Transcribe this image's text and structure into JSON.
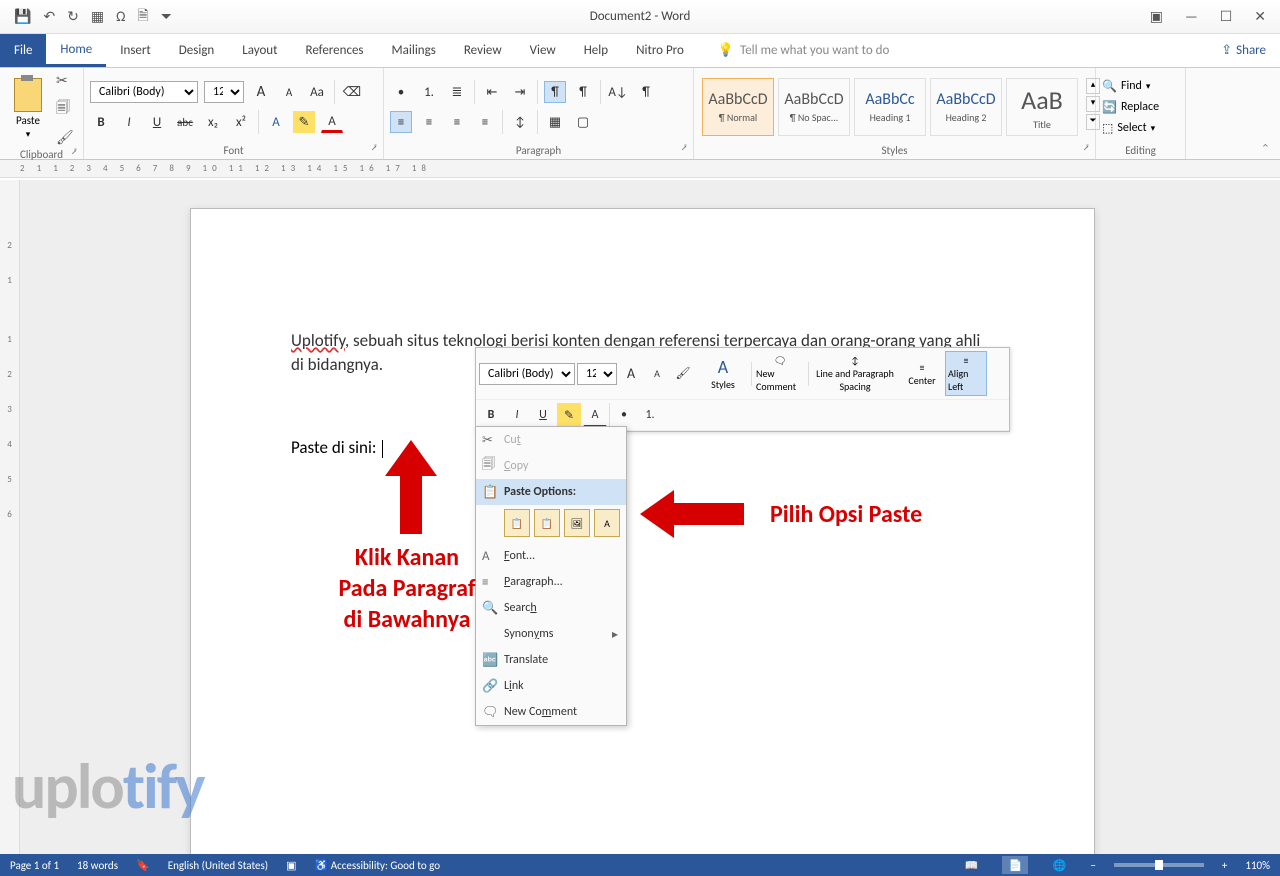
{
  "app": {
    "title": "Document2 - Word"
  },
  "qat": {
    "save": "💾",
    "undo": "↶",
    "redo": "↻",
    "xls": "▦",
    "omega": "Ω",
    "page": "🗎",
    "more": "⏷"
  },
  "wincontrols": {
    "display": "▣",
    "min": "—",
    "max": "☐",
    "close": "✕"
  },
  "tabs": {
    "file": "File",
    "home": "Home",
    "insert": "Insert",
    "design": "Design",
    "layout": "Layout",
    "references": "References",
    "mailings": "Mailings",
    "review": "Review",
    "view": "View",
    "help": "Help",
    "nitro": "Nitro Pro",
    "tellme": "Tell me what you want to do",
    "share": "Share"
  },
  "ribbon": {
    "clipboard": {
      "label": "Clipboard",
      "paste": "Paste",
      "cut": "✂",
      "copy": "🗐",
      "painter": "🖌"
    },
    "font": {
      "label": "Font",
      "name": "Calibri (Body)",
      "size": "12",
      "grow": "A",
      "shrink": "A",
      "case": "Aa",
      "clear": "⌫",
      "bold": "B",
      "italic": "I",
      "underline": "U",
      "strike": "abc",
      "sub": "x₂",
      "sup": "x²",
      "effects": "A",
      "highlight": "✎",
      "color": "A"
    },
    "para": {
      "label": "Paragraph",
      "bul": "•",
      "num": "1.",
      "multi": "≣",
      "dec": "⇤",
      "inc": "⇥",
      "sort": "A↓",
      "marks": "¶",
      "al": "≡",
      "ac": "≡",
      "ar": "≡",
      "aj": "≡",
      "ls": "↕",
      "shade": "▦",
      "border": "▢"
    },
    "styles": {
      "label": "Styles",
      "items": [
        {
          "preview": "AaBbCcD",
          "name": "¶ Normal"
        },
        {
          "preview": "AaBbCcD",
          "name": "¶ No Spac..."
        },
        {
          "preview": "AaBbCc",
          "name": "Heading 1"
        },
        {
          "preview": "AaBbCcD",
          "name": "Heading 2"
        },
        {
          "preview": "AaB",
          "name": "Title"
        }
      ]
    },
    "editing": {
      "label": "Editing",
      "find": "Find",
      "replace": "Replace",
      "select": "Select"
    }
  },
  "ruler": {
    "h": "2   1       1   2   3   4   5   6   7   8   9   10  11  12  13  14  15  16  17  18"
  },
  "doc": {
    "span1": "Uplotify",
    "span2": ", sebuah situs teknologi berisi konten dengan referensi terpercaya dan orang-orang yang ahli di bidangnya.",
    "para2": "Paste di sini: "
  },
  "mini": {
    "font": "Calibri (Body)",
    "size": "12",
    "grow": "A",
    "shrink": "A",
    "painter": "🖌",
    "stylesIcon": "A",
    "styles": "Styles",
    "commentIcon": "🗨",
    "comment": "New Comment",
    "spacingIcon": "↕",
    "spacing": "Line and Paragraph Spacing",
    "center": "Center",
    "alignleft": "Align Left",
    "bold": "B",
    "italic": "I",
    "underline": "U",
    "highlight": "✎",
    "color": "A",
    "bul": "•",
    "num": "1."
  },
  "ctx": {
    "cut": "t",
    "cutPre": "Cu",
    "copy": "C",
    "copyPost": "opy",
    "poLabel": "Paste Options:",
    "po": [
      "📋",
      "📋",
      "🖼",
      "A"
    ],
    "font": "F",
    "fontPost": "ont...",
    "para": "P",
    "paraPost": "aragraph...",
    "search": "Searc",
    "searchU": "h",
    "syn": "Synon",
    "synU": "y",
    "synPost": "ms",
    "translate": "Translate",
    "linkPre": "L",
    "linkU": "i",
    "linkPost": "nk",
    "nc": "New Co",
    "ncU": "m",
    "ncPost": "ment"
  },
  "anno": {
    "left1": "Klik Kanan",
    "left2": "Pada Paragraf",
    "left3": "di Bawahnya",
    "right": "Pilih Opsi Paste"
  },
  "watermark": {
    "a": "uplo",
    "b": "tify"
  },
  "status": {
    "page": "Page 1 of 1",
    "words": "18 words",
    "lang": "English (United States)",
    "acc": "Accessibility: Good to go",
    "zoom": "110%",
    "plus": "+",
    "minus": "−"
  }
}
